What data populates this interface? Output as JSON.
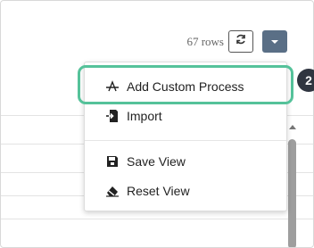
{
  "toolbar": {
    "rows_count": "67 rows",
    "refresh_icon": "refresh-icon",
    "dropdown_icon": "caret-down-icon"
  },
  "menu": {
    "items": [
      {
        "label": "Add Custom Process",
        "icon": "custom-process-icon"
      },
      {
        "label": "Import",
        "icon": "import-icon"
      },
      {
        "label": "Save View",
        "icon": "save-icon"
      },
      {
        "label": "Reset View",
        "icon": "eraser-icon"
      }
    ]
  },
  "callout": {
    "step": "2",
    "color": "#55c29a"
  },
  "colors": {
    "dropdown_bg": "#5a6f86",
    "badge_bg": "#2f3540"
  }
}
